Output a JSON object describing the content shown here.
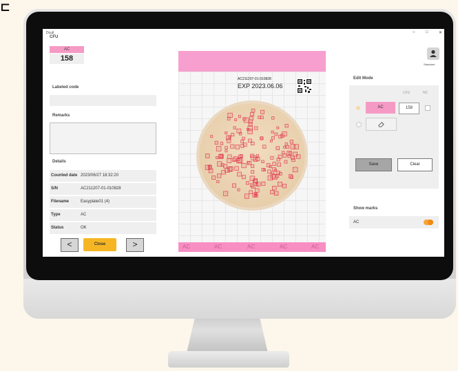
{
  "app": {
    "title": "Dcuil",
    "window_controls": [
      "–",
      "□",
      "✕"
    ]
  },
  "left": {
    "cfu_label": "CFU",
    "ac_label": "AC",
    "count": "158",
    "labeled_code_label": "Labeled code",
    "remarks_label": "Remarks",
    "details_label": "Details",
    "details": [
      {
        "key": "Counted date",
        "value": "2023/06/27 18:32:20"
      },
      {
        "key": "S/N",
        "value": "AC211207-01-010828"
      },
      {
        "key": "Filename",
        "value": "Easyplate01 (4)"
      },
      {
        "key": "Type",
        "value": "AC"
      },
      {
        "key": "Status",
        "value": "OK"
      }
    ],
    "prev_label": "<",
    "next_label": ">",
    "close_label": "Close"
  },
  "plate": {
    "code": "AC211207-01-010828",
    "exp": "EXP 2023.06.06",
    "strip_labels": [
      "AC",
      "AC",
      "AC",
      "AC",
      "AC"
    ]
  },
  "right": {
    "user_label": "Standard",
    "edit_mode_label": "Edit Mode",
    "col_cfu": "CFU",
    "col_nc": "NC",
    "ac_button": "AC",
    "count_value": "158",
    "save_label": "Save",
    "clear_label": "Clear",
    "show_marks_label": "Show marks",
    "marks_item_label": "AC"
  },
  "colors": {
    "pink": "#f59ac5",
    "orange": "#f6b624",
    "toggle": "#f08a12"
  }
}
